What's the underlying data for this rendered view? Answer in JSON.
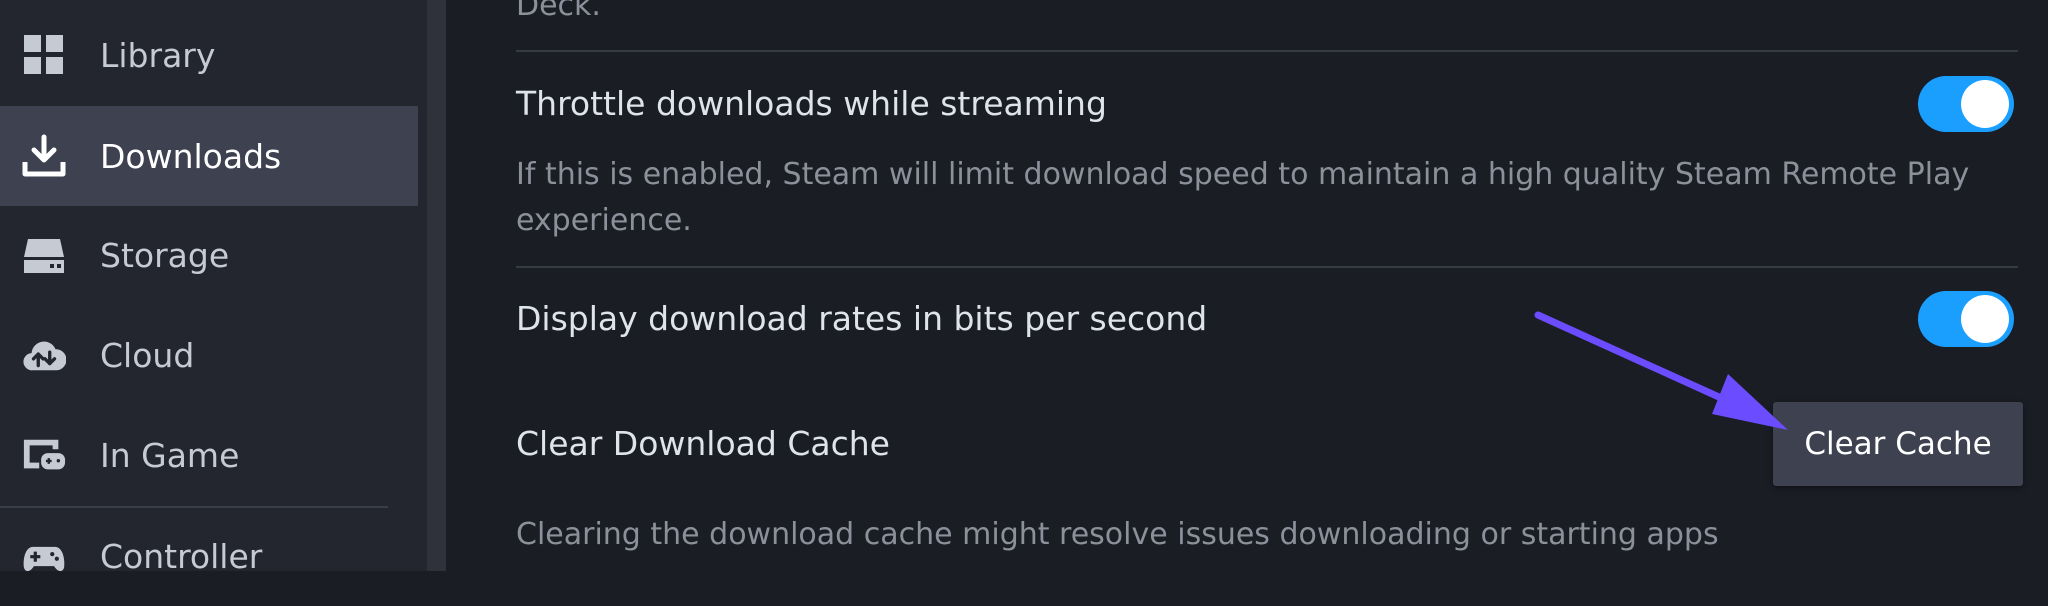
{
  "sidebar": {
    "items": [
      {
        "label": "Library",
        "icon": "grid-icon"
      },
      {
        "label": "Downloads",
        "icon": "download-icon",
        "active": true
      },
      {
        "label": "Storage",
        "icon": "storage-drive-icon"
      },
      {
        "label": "Cloud",
        "icon": "cloud-sync-icon"
      },
      {
        "label": "In Game",
        "icon": "in-game-icon"
      },
      {
        "label": "Controller",
        "icon": "gamepad-icon"
      }
    ]
  },
  "content": {
    "top_desc_tail": "Deck.",
    "throttle": {
      "label": "Throttle downloads while streaming",
      "description_line1": "If this is enabled, Steam will limit download speed to maintain a high quality Steam Remote Play",
      "description_line2": "experience.",
      "enabled": true
    },
    "bits": {
      "label": "Display download rates in bits per second",
      "enabled": true
    },
    "cache": {
      "label": "Clear Download Cache",
      "button_label": "Clear Cache",
      "description": "Clearing the download cache might resolve issues downloading or starting apps"
    }
  },
  "colors": {
    "accent": "#1a9fff",
    "annotation_arrow": "#6b4dff",
    "background": "#1a1d24",
    "sidebar": "#23262e"
  }
}
